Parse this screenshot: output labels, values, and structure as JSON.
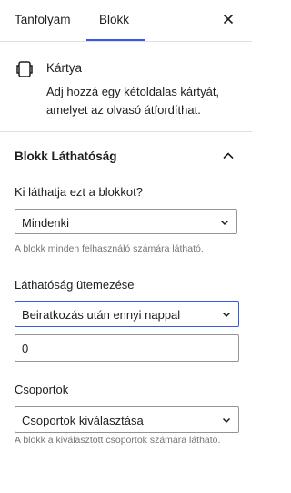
{
  "tabs": [
    {
      "label": "Tanfolyam",
      "active": false
    },
    {
      "label": "Blokk",
      "active": true
    }
  ],
  "accent_color": "#3858e9",
  "close_icon": "close-icon",
  "block": {
    "icon": "flip-card-icon",
    "title": "Kártya",
    "description": "Adj hozzá egy kétoldalas kártyát, amelyet az olvasó átfordíthat."
  },
  "visibility_panel": {
    "title": "Blokk Láthatóság",
    "expanded": true,
    "who_label": "Ki láthatja ezt a blokkot?",
    "who_value": "Mindenki",
    "who_help": "A blokk minden felhasználó számára látható.",
    "schedule_label": "Láthatóság ütemezése",
    "schedule_value": "Beiratkozás után ennyi nappal",
    "days_value": "0",
    "groups_label": "Csoportok",
    "groups_value": "Csoportok kiválasztása",
    "groups_help": "A blokk a kiválasztott csoportok számára látható."
  }
}
